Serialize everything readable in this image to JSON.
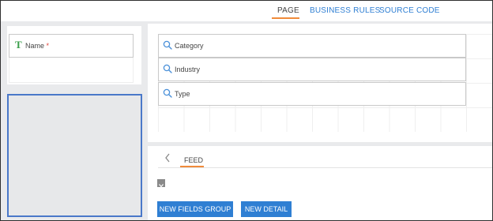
{
  "top_tabs": {
    "page": "PAGE",
    "business_rules": "BUSINESS RULES",
    "source_code": "SOURCE CODE"
  },
  "name_field": {
    "label": "Name",
    "required_mark": "*",
    "icon": "text-type-icon"
  },
  "lookups": [
    {
      "label": "Category",
      "icon": "search-icon"
    },
    {
      "label": "Industry",
      "icon": "search-icon"
    },
    {
      "label": "Type",
      "icon": "search-icon"
    }
  ],
  "detail_tabs": {
    "feed": "FEED"
  },
  "buttons": {
    "new_fields_group": "NEW FIELDS GROUP",
    "new_detail": "NEW DETAIL"
  },
  "colors": {
    "accent_orange": "#f08b3a",
    "link_blue": "#2f7fd3",
    "selection_blue": "#4a78c9",
    "required_red": "#e0443a",
    "text_icon_green": "#3a9e4a"
  }
}
